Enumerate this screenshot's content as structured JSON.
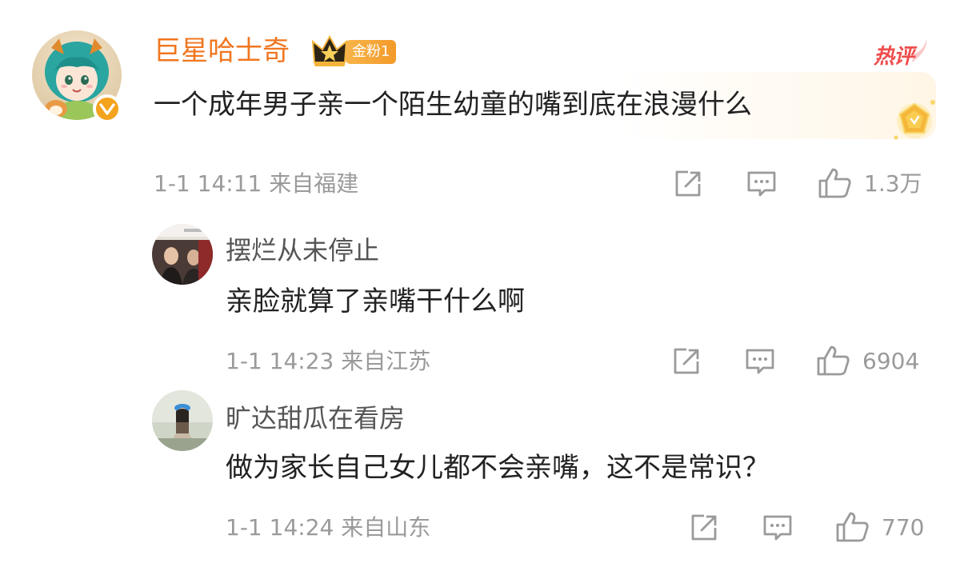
{
  "main_comment": {
    "username": "巨星哈士奇",
    "fan_badge": "金粉1",
    "hot_tag": "热评",
    "text": "一个成年男子亲一个陌生幼童的嘴到底在浪漫什么",
    "time_location": "1-1 14:11 来自福建",
    "like_count": "1.3万",
    "colors": {
      "name": "#f0761f",
      "hot": "#ef4d4d",
      "verify": "#f4a31d"
    }
  },
  "replies": [
    {
      "username": "摆烂从未停止",
      "text": "亲脸就算了亲嘴干什么啊",
      "time_location": "1-1 14:23 来自江苏",
      "like_count": "6904"
    },
    {
      "username": "旷达甜瓜在看房",
      "text": "做为家长自己女儿都不会亲嘴，这不是常识？",
      "time_location": "1-1 14:24 来自山东",
      "like_count": "770"
    }
  ],
  "icons": [
    "share-icon",
    "comment-icon",
    "like-icon",
    "verified-icon",
    "crown-icon",
    "gem-icon"
  ]
}
